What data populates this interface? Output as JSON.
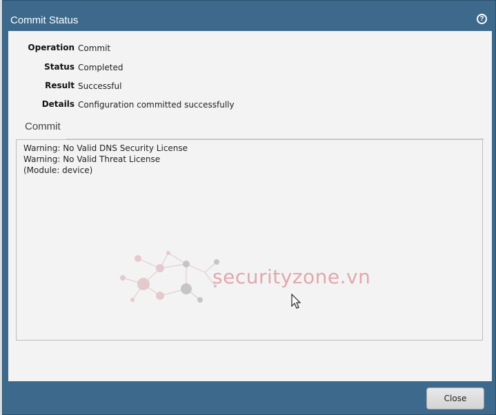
{
  "dialog": {
    "title": "Commit Status",
    "help_icon": "help-icon"
  },
  "fields": [
    {
      "label": "Operation",
      "value": "Commit"
    },
    {
      "label": "Status",
      "value": "Completed"
    },
    {
      "label": "Result",
      "value": "Successful"
    },
    {
      "label": "Details",
      "value": "Configuration committed successfully"
    }
  ],
  "section": {
    "title": "Commit",
    "log_lines": [
      "Warning: No Valid DNS Security License",
      "Warning: No Valid Threat License",
      "(Module: device)"
    ]
  },
  "watermark": {
    "logo": "network-graph-logo",
    "text": "securityzone.vn"
  },
  "footer": {
    "close_label": "Close"
  },
  "colors": {
    "titlebar": "#3d6a8c",
    "body_bg": "#f3f3f3"
  }
}
